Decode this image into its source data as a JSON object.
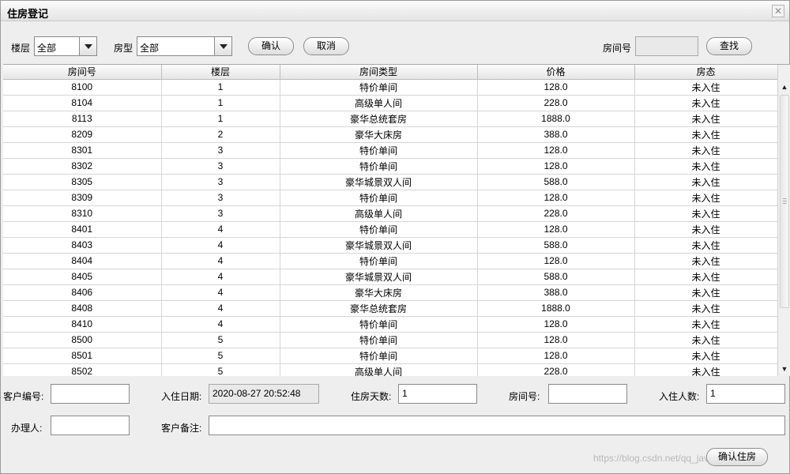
{
  "window": {
    "title": "住房登记",
    "close_glyph": "✕"
  },
  "filters": {
    "floor_label": "楼层",
    "floor_value": "全部",
    "roomtype_label": "房型",
    "roomtype_value": "全部",
    "confirm_label": "确认",
    "cancel_label": "取消",
    "room_no_label": "房间号",
    "room_no_value": "",
    "search_label": "查找"
  },
  "table": {
    "columns": [
      "房间号",
      "楼层",
      "房间类型",
      "价格",
      "房态"
    ],
    "rows": [
      [
        "8100",
        "1",
        "特价单间",
        "128.0",
        "未入住"
      ],
      [
        "8104",
        "1",
        "高级单人间",
        "228.0",
        "未入住"
      ],
      [
        "8113",
        "1",
        "豪华总统套房",
        "1888.0",
        "未入住"
      ],
      [
        "8209",
        "2",
        "豪华大床房",
        "388.0",
        "未入住"
      ],
      [
        "8301",
        "3",
        "特价单间",
        "128.0",
        "未入住"
      ],
      [
        "8302",
        "3",
        "特价单间",
        "128.0",
        "未入住"
      ],
      [
        "8305",
        "3",
        "豪华城景双人间",
        "588.0",
        "未入住"
      ],
      [
        "8309",
        "3",
        "特价单间",
        "128.0",
        "未入住"
      ],
      [
        "8310",
        "3",
        "高级单人间",
        "228.0",
        "未入住"
      ],
      [
        "8401",
        "4",
        "特价单间",
        "128.0",
        "未入住"
      ],
      [
        "8403",
        "4",
        "豪华城景双人间",
        "588.0",
        "未入住"
      ],
      [
        "8404",
        "4",
        "特价单间",
        "128.0",
        "未入住"
      ],
      [
        "8405",
        "4",
        "豪华城景双人间",
        "588.0",
        "未入住"
      ],
      [
        "8406",
        "4",
        "豪华大床房",
        "388.0",
        "未入住"
      ],
      [
        "8408",
        "4",
        "豪华总统套房",
        "1888.0",
        "未入住"
      ],
      [
        "8410",
        "4",
        "特价单间",
        "128.0",
        "未入住"
      ],
      [
        "8500",
        "5",
        "特价单间",
        "128.0",
        "未入住"
      ],
      [
        "8501",
        "5",
        "特价单间",
        "128.0",
        "未入住"
      ],
      [
        "8502",
        "5",
        "高级单人间",
        "228.0",
        "未入住"
      ]
    ]
  },
  "form": {
    "customer_id_label": "客户编号:",
    "customer_id_value": "",
    "checkin_date_label": "入住日期:",
    "checkin_date_value": "2020-08-27 20:52:48",
    "stay_days_label": "住房天数:",
    "stay_days_value": "1",
    "room_no_label": "房间号:",
    "room_no_value": "",
    "guest_count_label": "入住人数:",
    "guest_count_value": "1",
    "handler_label": "办理人:",
    "handler_value": "",
    "remark_label": "客户备注:",
    "remark_value": "",
    "submit_label": "确认住房"
  },
  "watermark": "https://blog.csdn.net/qq_java",
  "icons": {
    "up": "scroll-up-arrow",
    "down": "scroll-down-arrow",
    "combo": "chevron-down"
  }
}
